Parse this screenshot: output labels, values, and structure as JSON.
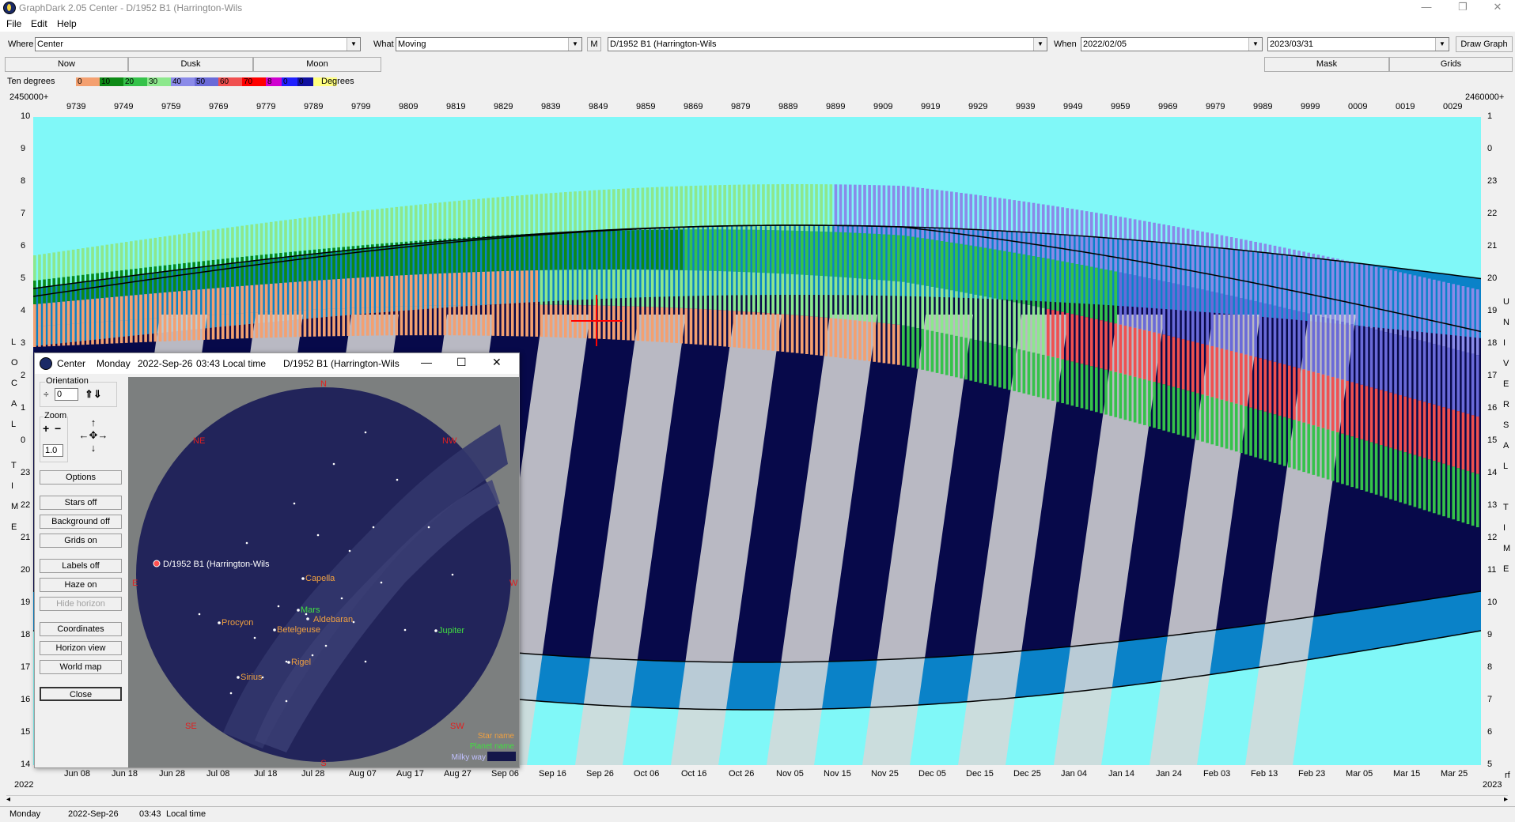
{
  "window": {
    "title": "GraphDark 2.05  Center  -  D/1952 B1 (Harrington-Wils",
    "controls": {
      "minimize": "—",
      "maximize": "❐",
      "close": "✕"
    }
  },
  "menu": {
    "items": [
      "File",
      "Edit",
      "Help"
    ]
  },
  "toolbar": {
    "where_label": "Where",
    "where_value": "Center",
    "what_label": "What",
    "what_value": "Moving",
    "m_button": "M",
    "object_value": "D/1952 B1 (Harrington-Wils",
    "when_label": "When",
    "start_date": "2022/02/05",
    "end_date": "2023/03/31",
    "draw_button": "Draw Graph"
  },
  "buttons_row": {
    "now": "Now",
    "dusk": "Dusk",
    "moon": "Moon",
    "mask": "Mask",
    "grids": "Grids"
  },
  "legend": {
    "left_label": "Ten degrees",
    "right_label": "Degrees",
    "swatches": [
      {
        "label": "0",
        "color": "#f4a070"
      },
      {
        "label": "10",
        "color": "#0e8a16"
      },
      {
        "label": "20",
        "color": "#35c24a"
      },
      {
        "label": "30",
        "color": "#8de88d"
      },
      {
        "label": "40",
        "color": "#8a8ae8"
      },
      {
        "label": "50",
        "color": "#6a6ad8"
      },
      {
        "label": "60",
        "color": "#f05050"
      },
      {
        "label": "70",
        "color": "#ff0000"
      },
      {
        "label": "8",
        "color": "#d000d0"
      },
      {
        "label": "0",
        "color": "#2020ff"
      },
      {
        "label": "0",
        "color": "#1010a0"
      },
      {
        "label": "",
        "color": "#ffff80"
      }
    ]
  },
  "graph": {
    "jd_left_label": "2450000+",
    "jd_right_label": "2460000+",
    "jd_ticks": [
      "9739",
      "9749",
      "9759",
      "9769",
      "9779",
      "9789",
      "9799",
      "9809",
      "9819",
      "9829",
      "9839",
      "9849",
      "9859",
      "9869",
      "9879",
      "9889",
      "9899",
      "9909",
      "9919",
      "9929",
      "9939",
      "9949",
      "9959",
      "9969",
      "9979",
      "9989",
      "9999",
      "0009",
      "0019",
      "0029"
    ],
    "left_ticks": [
      "10",
      "9",
      "8",
      "7",
      "6",
      "5",
      "4",
      "3",
      "2",
      "1",
      "0",
      "23",
      "22",
      "21",
      "20",
      "19",
      "18",
      "17",
      "16",
      "15",
      "14"
    ],
    "right_ticks": [
      "1",
      "0",
      "23",
      "22",
      "21",
      "20",
      "19",
      "18",
      "17",
      "16",
      "15",
      "14",
      "13",
      "12",
      "11",
      "10",
      "9",
      "8",
      "7",
      "6",
      "5"
    ],
    "left_axis_title": [
      "L",
      "O",
      "C",
      "A",
      "L",
      "",
      "T",
      "I",
      "M",
      "E"
    ],
    "right_axis_title": [
      "U",
      "N",
      "I",
      "V",
      "E",
      "R",
      "S",
      "A",
      "L",
      "",
      "T",
      "I",
      "M",
      "E"
    ],
    "date_ticks": [
      "Jun 08",
      "Jun 18",
      "Jun 28",
      "Jul 08",
      "Jul 18",
      "Jul 28",
      "Aug 07",
      "Aug 17",
      "Aug 27",
      "Sep 06",
      "Sep 16",
      "Sep 26",
      "Oct 06",
      "Oct 16",
      "Oct 26",
      "Nov 05",
      "Nov 15",
      "Nov 25",
      "Dec 05",
      "Dec 15",
      "Dec 25",
      "Jan 04",
      "Jan 14",
      "Jan 24",
      "Feb 03",
      "Feb 13",
      "Feb 23",
      "Mar 05",
      "Mar 15",
      "Mar 25"
    ],
    "year_left": "2022",
    "year_right": "2023",
    "corner_right": "rf",
    "colors": {
      "sky_day": "#80f8f8",
      "night": "#07094a",
      "twilight": "#0a82c8",
      "moon": "#d8d8d8"
    }
  },
  "status": {
    "day": "Monday",
    "date": "2022-Sep-26",
    "time": "03:43",
    "tz": "Local time"
  },
  "dialog": {
    "title_app": "Center",
    "title_day": "Monday",
    "title_date": "2022-Sep-26",
    "title_time": "03:43 Local time",
    "title_object": "D/1952 B1 (Harrington-Wils",
    "orientation_label": "Orientation",
    "orientation_value": "0",
    "zoom_label": "Zoom",
    "zoom_value": "1.0",
    "buttons": {
      "options": "Options",
      "stars": "Stars off",
      "background": "Background off",
      "grids": "Grids on",
      "labels": "Labels off",
      "haze": "Haze on",
      "hide_horizon": "Hide horizon",
      "coordinates": "Coordinates",
      "horizon_view": "Horizon view",
      "world_map": "World map",
      "close": "Close"
    },
    "compass": {
      "n": "N",
      "ne": "NE",
      "nw": "NW",
      "e": "E",
      "w": "W",
      "se": "SE",
      "sw": "SW",
      "s": "S"
    },
    "sky_labels": {
      "comet": "D/1952 B1 (Harrington-Wils",
      "capella": "Capella",
      "mars": "Mars",
      "aldebaran": "Aldebaran",
      "procyon": "Procyon",
      "betelgeuse": "Betelgeuse",
      "jupiter": "Jupiter",
      "rigel": "Rigel",
      "sirius": "Sirius"
    },
    "key": {
      "star": "Star name",
      "planet": "Planet name",
      "milky": "Milky way"
    }
  }
}
